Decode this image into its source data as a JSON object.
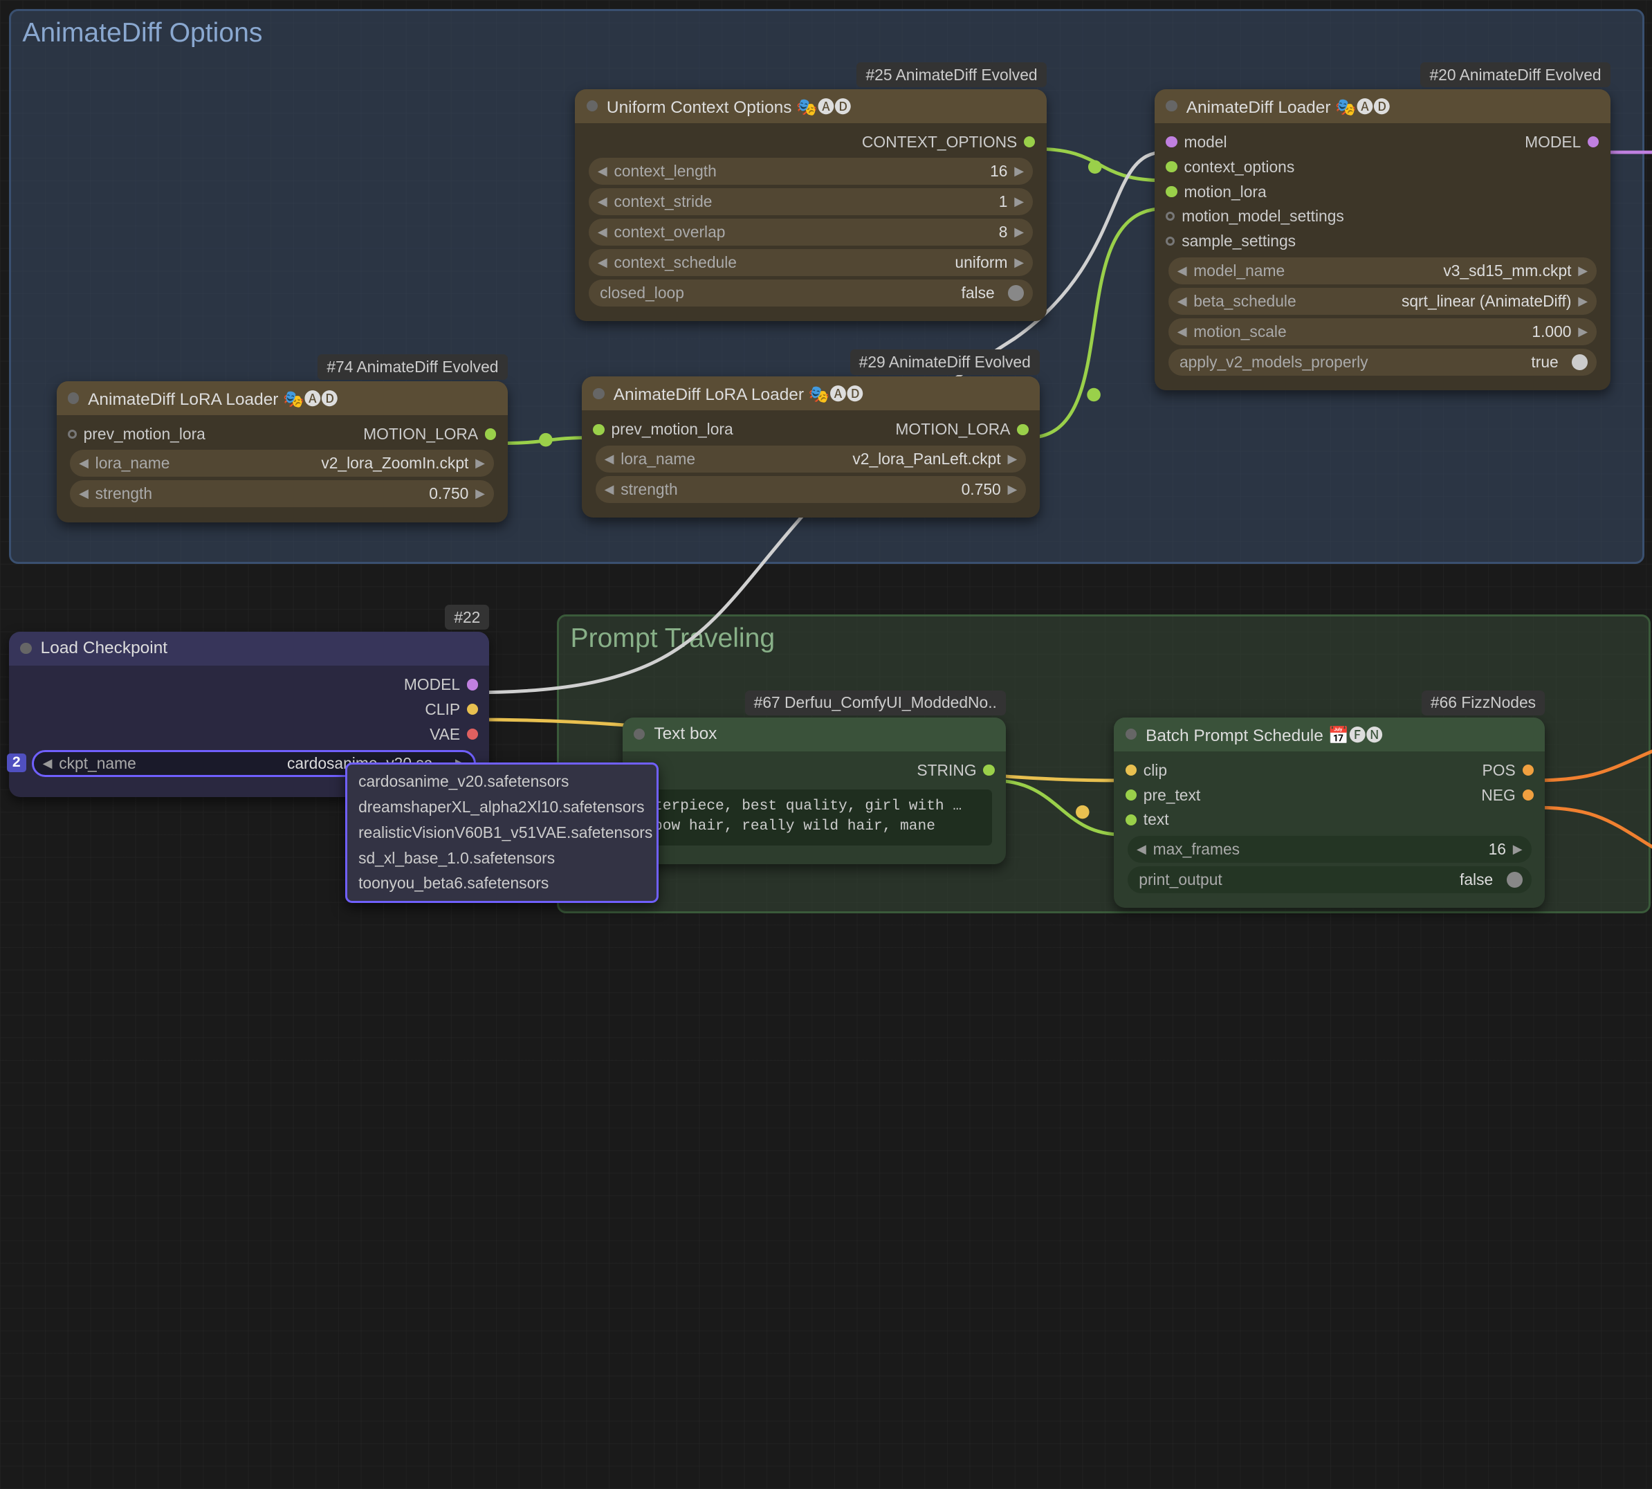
{
  "groups": {
    "ad": {
      "title": "AnimateDiff Options"
    },
    "pt": {
      "title": "Prompt Traveling"
    }
  },
  "nodes": {
    "uco": {
      "tag": "#25 AnimateDiff Evolved",
      "title": "Uniform Context Options 🎭🅐🅓",
      "out0": "CONTEXT_OPTIONS",
      "w": {
        "context_length": {
          "label": "context_length",
          "val": "16"
        },
        "context_stride": {
          "label": "context_stride",
          "val": "1"
        },
        "context_overlap": {
          "label": "context_overlap",
          "val": "8"
        },
        "context_schedule": {
          "label": "context_schedule",
          "val": "uniform"
        },
        "closed_loop": {
          "label": "closed_loop",
          "val": "false"
        }
      }
    },
    "adl": {
      "tag": "#20 AnimateDiff Evolved",
      "title": "AnimateDiff Loader 🎭🅐🅓",
      "in": {
        "model": "model",
        "context_options": "context_options",
        "motion_lora": "motion_lora",
        "motion_model_settings": "motion_model_settings",
        "sample_settings": "sample_settings"
      },
      "out0": "MODEL",
      "w": {
        "model_name": {
          "label": "model_name",
          "val": "v3_sd15_mm.ckpt"
        },
        "beta_schedule": {
          "label": "beta_schedule",
          "val": "sqrt_linear (AnimateDiff)"
        },
        "motion_scale": {
          "label": "motion_scale",
          "val": "1.000"
        },
        "apply_v2": {
          "label": "apply_v2_models_properly",
          "val": "true"
        }
      }
    },
    "lora74": {
      "tag": "#74 AnimateDiff Evolved",
      "title": "AnimateDiff LoRA Loader 🎭🅐🅓",
      "in_prev": "prev_motion_lora",
      "out0": "MOTION_LORA",
      "w": {
        "lora_name": {
          "label": "lora_name",
          "val": "v2_lora_ZoomIn.ckpt"
        },
        "strength": {
          "label": "strength",
          "val": "0.750"
        }
      }
    },
    "lora29": {
      "tag": "#29 AnimateDiff Evolved",
      "title": "AnimateDiff LoRA Loader 🎭🅐🅓",
      "in_prev": "prev_motion_lora",
      "out0": "MOTION_LORA",
      "w": {
        "lora_name": {
          "label": "lora_name",
          "val": "v2_lora_PanLeft.ckpt"
        },
        "strength": {
          "label": "strength",
          "val": "0.750"
        }
      }
    },
    "ckpt": {
      "tag": "#22",
      "title": "Load Checkpoint",
      "out": {
        "model": "MODEL",
        "clip": "CLIP",
        "vae": "VAE"
      },
      "queue": "2",
      "w": {
        "ckpt_name": {
          "label": "ckpt_name",
          "val": "cardosanime_v20.sa…"
        }
      }
    },
    "textbox": {
      "tag": "#67 Derfuu_ComfyUI_ModdedNo..",
      "title": "Text box",
      "out0": "STRING",
      "text": "…terpiece, best quality, girl with …nbow hair, really wild hair, mane"
    },
    "bps": {
      "tag": "#66 FizzNodes",
      "title": "Batch Prompt Schedule 📅🅕🅝",
      "in": {
        "clip": "clip",
        "pre_text": "pre_text",
        "text": "text"
      },
      "out": {
        "pos": "POS",
        "neg": "NEG"
      },
      "w": {
        "max_frames": {
          "label": "max_frames",
          "val": "16"
        },
        "print_output": {
          "label": "print_output",
          "val": "false"
        }
      }
    }
  },
  "dropdown": {
    "items": [
      "cardosanime_v20.safetensors",
      "dreamshaperXL_alpha2Xl10.safetensors",
      "realisticVisionV60B1_v51VAE.safetensors",
      "sd_xl_base_1.0.safetensors",
      "toonyou_beta6.safetensors"
    ]
  }
}
